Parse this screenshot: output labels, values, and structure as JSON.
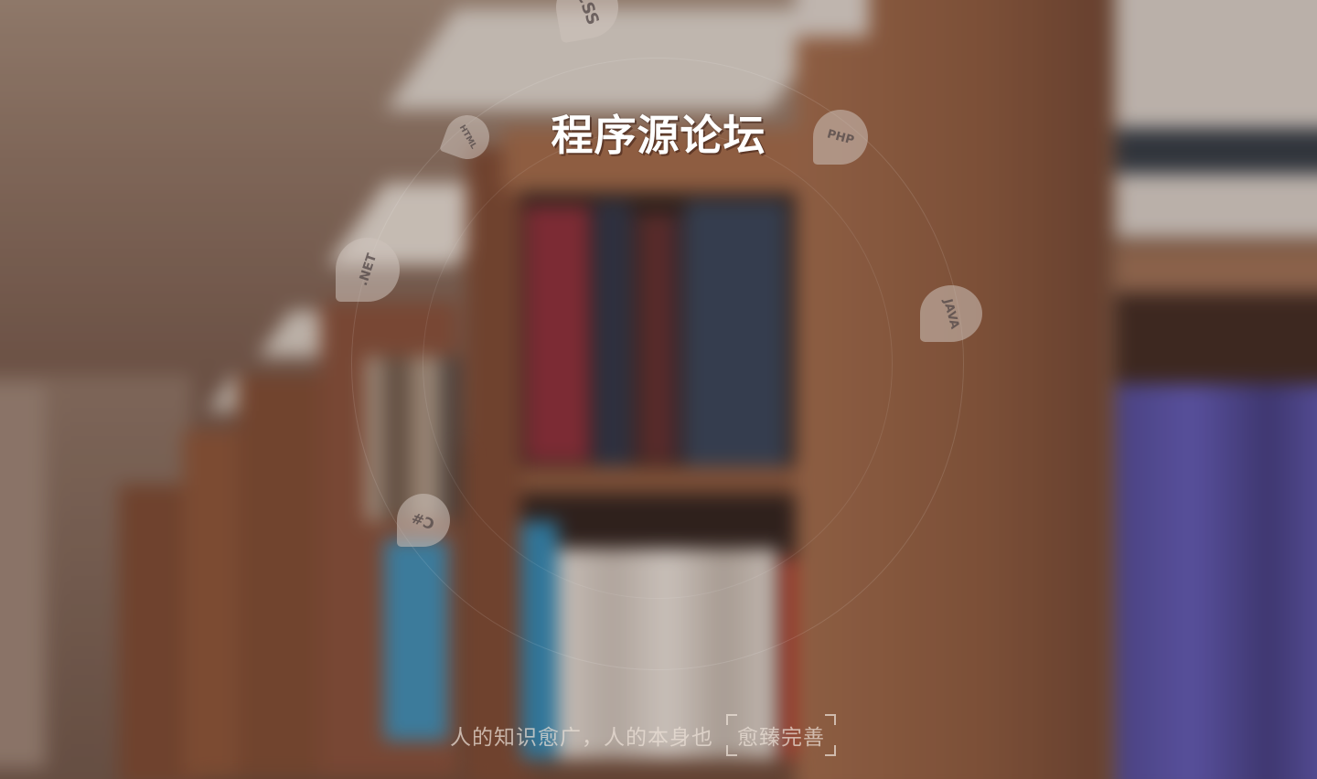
{
  "site": {
    "title": "程序源论坛"
  },
  "tech_bubbles": [
    {
      "label": "CSS"
    },
    {
      "label": "HTML"
    },
    {
      "label": "PHP"
    },
    {
      "label": ".NET"
    },
    {
      "label": "JAVA"
    },
    {
      "label": "C#"
    }
  ],
  "slogan": {
    "prefix": "人的知识愈广，人的本身也",
    "highlight": "愈臻完善"
  },
  "colors": {
    "title": "#ffffff",
    "bubble_bg": "#cdc3bc",
    "slogan_text": "#ebe1d7"
  }
}
